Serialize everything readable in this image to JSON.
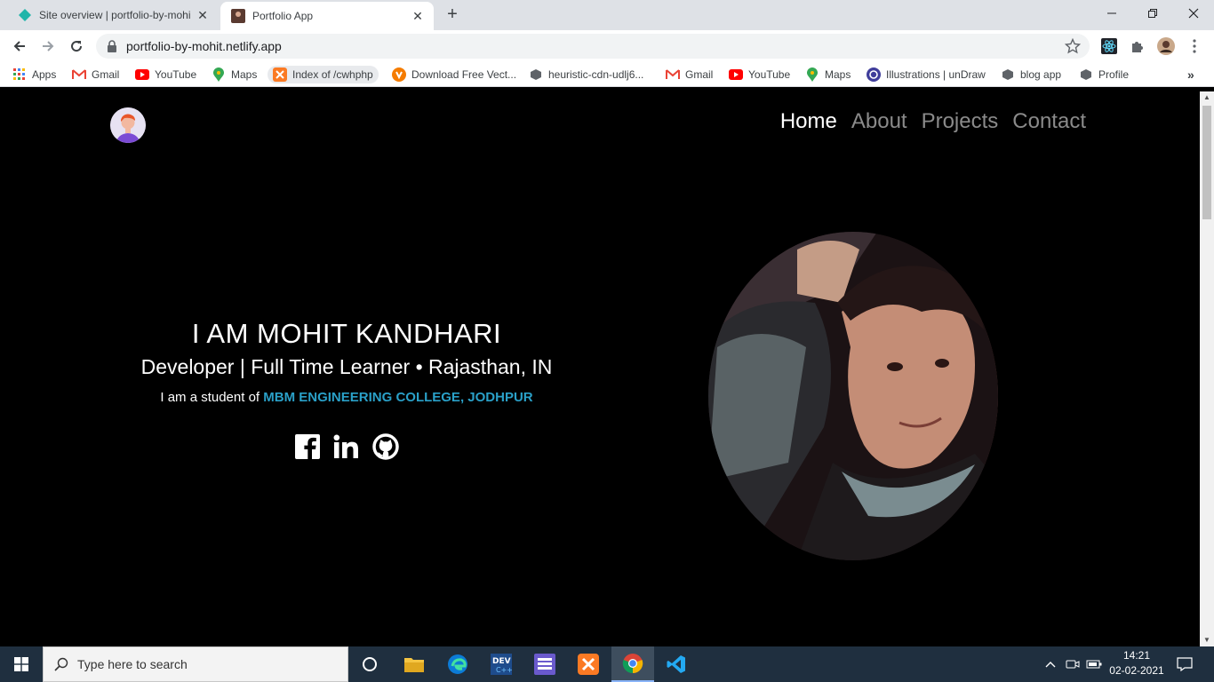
{
  "browser": {
    "tabs": [
      {
        "title": "Site overview | portfolio-by-mohi",
        "active": false
      },
      {
        "title": "Portfolio App",
        "active": true
      }
    ],
    "url": "portfolio-by-mohit.netlify.app",
    "bookmarks": [
      {
        "label": "Apps",
        "icon": "apps-grid-icon"
      },
      {
        "label": "Gmail",
        "icon": "gmail-icon"
      },
      {
        "label": "YouTube",
        "icon": "youtube-icon"
      },
      {
        "label": "Maps",
        "icon": "maps-icon"
      },
      {
        "label": "Index of /cwhphp",
        "icon": "xampp-icon"
      },
      {
        "label": "Download Free Vect...",
        "icon": "vector-site-icon"
      },
      {
        "label": "heuristic-cdn-udlj6...",
        "icon": "cube-icon"
      },
      {
        "label": "Gmail",
        "icon": "gmail-icon"
      },
      {
        "label": "YouTube",
        "icon": "youtube-icon"
      },
      {
        "label": "Maps",
        "icon": "maps-icon"
      },
      {
        "label": "Illustrations | unDraw",
        "icon": "undraw-icon"
      },
      {
        "label": "blog app",
        "icon": "cube-icon"
      },
      {
        "label": "Profile",
        "icon": "cube-icon"
      }
    ],
    "bookmarks_more": "»"
  },
  "site": {
    "nav": [
      {
        "label": "Home",
        "active": true
      },
      {
        "label": "About",
        "active": false
      },
      {
        "label": "Projects",
        "active": false
      },
      {
        "label": "Contact",
        "active": false
      }
    ],
    "hero": {
      "name": "I AM MOHIT KANDHARI",
      "subtitle": "Developer | Full Time Learner • Rajasthan, IN",
      "student_prefix": "I am a student of",
      "college": "MBM ENGINEERING COLLEGE, JODHPUR"
    },
    "socials": [
      "facebook-icon",
      "linkedin-icon",
      "github-icon"
    ],
    "colors": {
      "background": "#000000",
      "college": "#2aa0c8",
      "nav_active": "#ffffff",
      "nav_inactive": "#8a8a8a"
    }
  },
  "taskbar": {
    "search_placeholder": "Type here to search",
    "time": "14:21",
    "date": "02-02-2021"
  }
}
